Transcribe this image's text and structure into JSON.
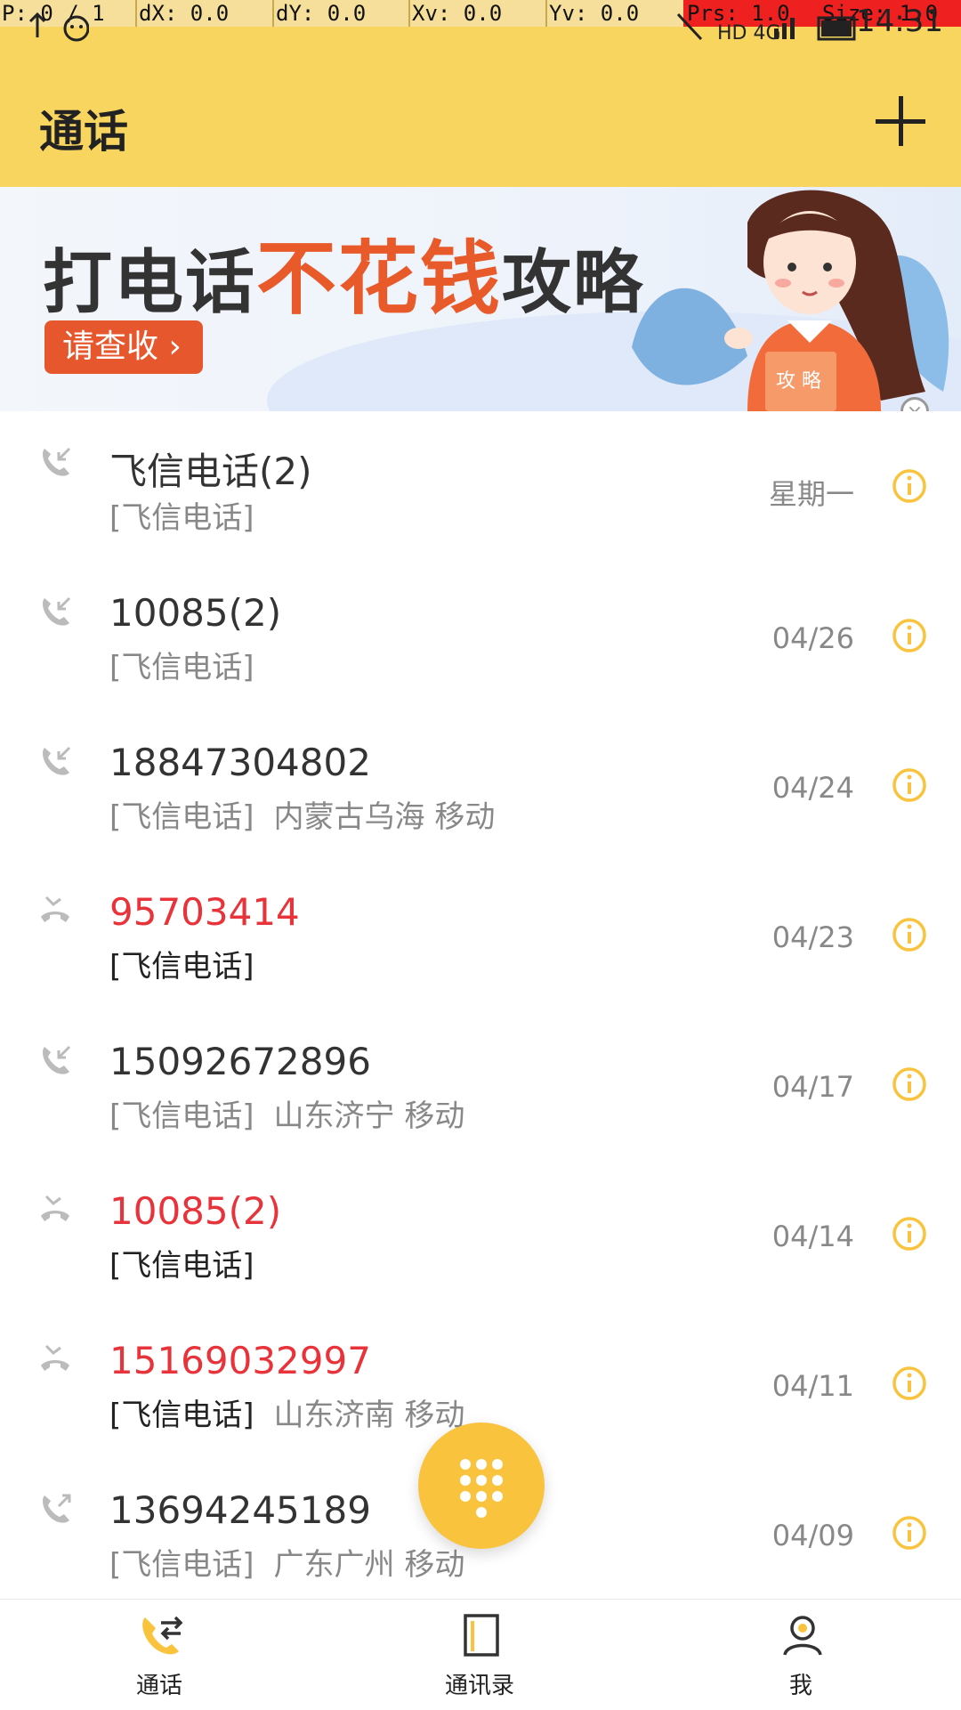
{
  "debug": {
    "p": "P: 0 / 1",
    "dx": "dX: 0.0",
    "dy": "dY: 0.0",
    "xv": "Xv: 0.0",
    "yv": "Yv: 0.0",
    "prs": "Prs: 1.0",
    "size": "Size: 1.0"
  },
  "status": {
    "time": "14:31",
    "network": "HD 4G"
  },
  "header": {
    "title": "通话"
  },
  "banner": {
    "headline_a": "打电话",
    "headline_b": "不花钱",
    "headline_c": "攻略",
    "cta": "请查收 ›",
    "book_label": "攻 略"
  },
  "calls": [
    {
      "name": "飞信电话(2)",
      "source": "[飞信电话]",
      "location": "",
      "date": "星期一",
      "type": "incoming"
    },
    {
      "name": "10085(2)",
      "source": "[飞信电话]",
      "location": "",
      "date": "04/26",
      "type": "incoming"
    },
    {
      "name": "18847304802",
      "source": "[飞信电话]",
      "location": "内蒙古乌海 移动",
      "date": "04/24",
      "type": "incoming"
    },
    {
      "name": "95703414",
      "source": "[飞信电话]",
      "location": "",
      "date": "04/23",
      "type": "missed"
    },
    {
      "name": "15092672896",
      "source": "[飞信电话]",
      "location": "山东济宁 移动",
      "date": "04/17",
      "type": "incoming"
    },
    {
      "name": "10085(2)",
      "source": "[飞信电话]",
      "location": "",
      "date": "04/14",
      "type": "missed"
    },
    {
      "name": "15169032997",
      "source": "[飞信电话]",
      "location": "山东济南 移动",
      "date": "04/11",
      "type": "missed"
    },
    {
      "name": "13694245189",
      "source": "[飞信电话]",
      "location": "广东广州 移动",
      "date": "04/09",
      "type": "outgoing"
    }
  ],
  "nav": {
    "calls": "通话",
    "contacts": "通讯录",
    "me": "我"
  },
  "colors": {
    "accent": "#f8d55f",
    "missed": "#e8333a",
    "info": "#f9c33d"
  }
}
